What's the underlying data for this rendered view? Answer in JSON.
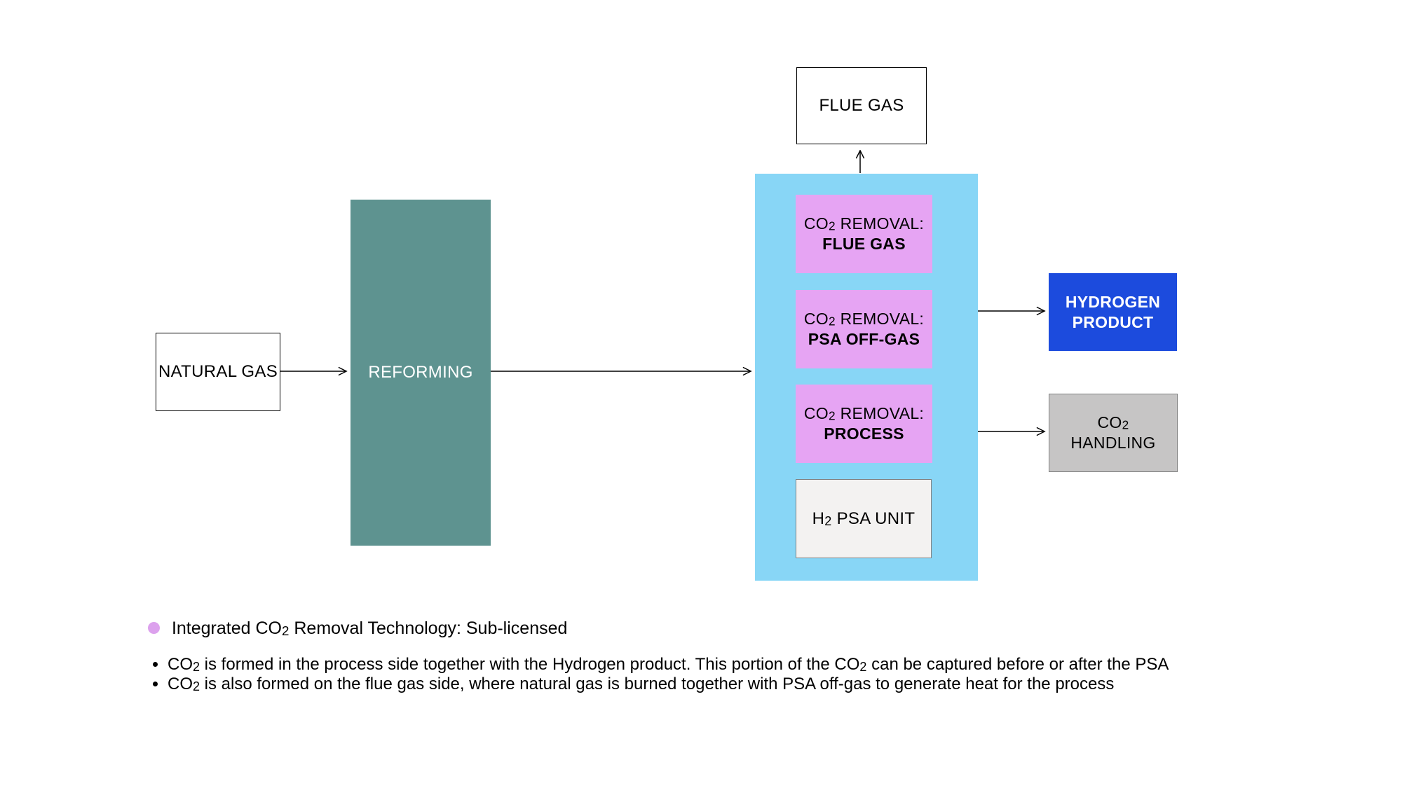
{
  "boxes": {
    "natural_gas": "NATURAL GAS",
    "reforming": "REFORMING",
    "flue_gas": "FLUE GAS",
    "co2_flue_pre": "CO",
    "co2_flue_mid": " REMOVAL:",
    "co2_flue_bold": "FLUE GAS",
    "co2_psa_pre": "CO",
    "co2_psa_mid": " REMOVAL:",
    "co2_psa_bold": "PSA OFF-GAS",
    "co2_proc_pre": "CO",
    "co2_proc_mid": " REMOVAL:",
    "co2_proc_bold": "PROCESS",
    "h2_psa_pre": "H",
    "h2_psa_rest": " PSA UNIT",
    "hydrogen_l1": "HYDROGEN",
    "hydrogen_l2": "PRODUCT",
    "co2_handling_pre": "CO",
    "co2_handling_l2": "HANDLING"
  },
  "sub2": "2",
  "legend": {
    "pre": "Integrated CO",
    "post": " Removal Technology: Sub-licensed"
  },
  "notes": {
    "n1_a": "CO",
    "n1_b": " is formed in the process side together with the Hydrogen product. This portion of the CO",
    "n1_c": " can be captured before or after the PSA",
    "n2_a": "CO",
    "n2_b": " is also formed on the flue gas side, where natural gas is burned together with PSA off-gas to generate heat for the process"
  }
}
